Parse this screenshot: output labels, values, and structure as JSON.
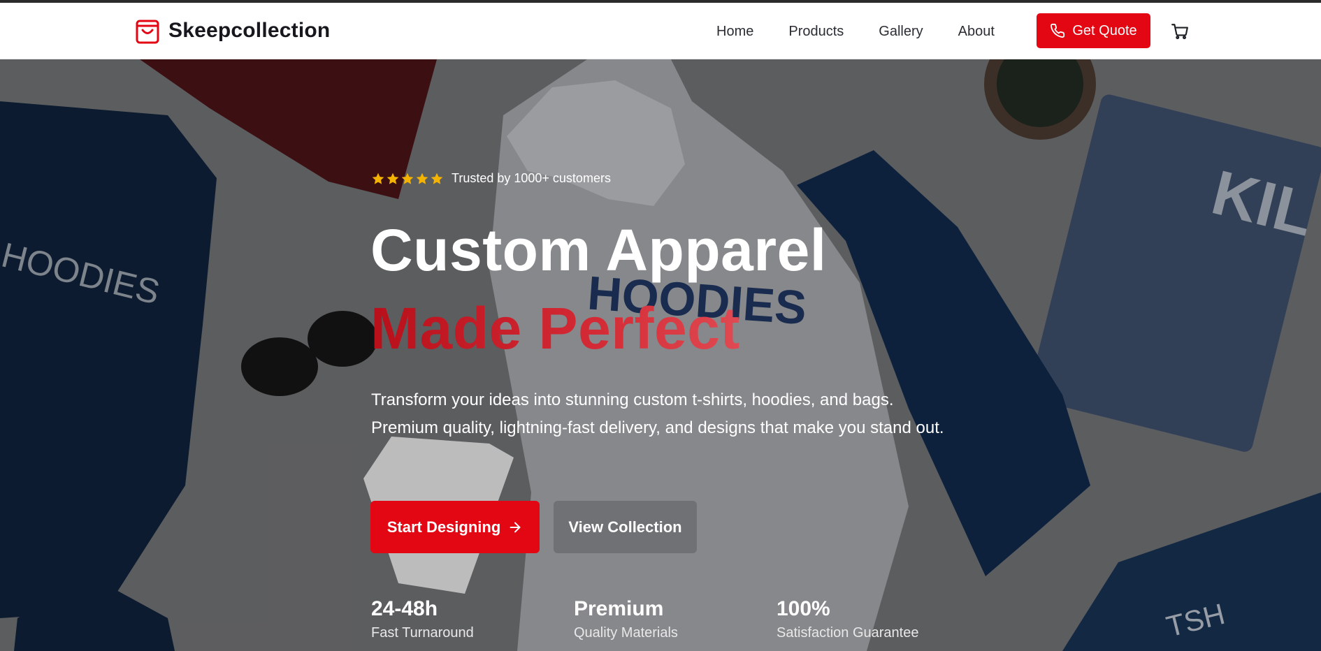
{
  "brand": {
    "name": "Skeepcollection",
    "icon": "shopping-bag-icon",
    "accent": "#e30613"
  },
  "nav": {
    "items": [
      "Home",
      "Products",
      "Gallery",
      "About"
    ]
  },
  "header": {
    "cta_label": "Get Quote",
    "cta_icon": "phone-icon",
    "cart_icon": "cart-icon"
  },
  "hero": {
    "rating_stars": 5,
    "trust_text": "Trusted by 1000+ customers",
    "title_line1": "Custom Apparel",
    "title_line2": "Made Perfect",
    "subtitle": "Transform your ideas into stunning custom t-shirts, hoodies, and bags. Premium quality, lightning-fast delivery, and designs that make you stand out.",
    "primary_cta": "Start Designing",
    "primary_cta_icon": "arrow-right-icon",
    "secondary_cta": "View Collection",
    "stats": [
      {
        "value": "24-48h",
        "label": "Fast Turnaround"
      },
      {
        "value": "Premium",
        "label": "Quality Materials"
      },
      {
        "value": "100%",
        "label": "Satisfaction Guarantee"
      }
    ],
    "background_image_text": [
      "HOODIES",
      "HOODIES",
      "KIL",
      "TSH"
    ],
    "colors": {
      "star": "#f5b301",
      "title_accent": "#c4161f",
      "primary_button": "#e30613"
    }
  }
}
